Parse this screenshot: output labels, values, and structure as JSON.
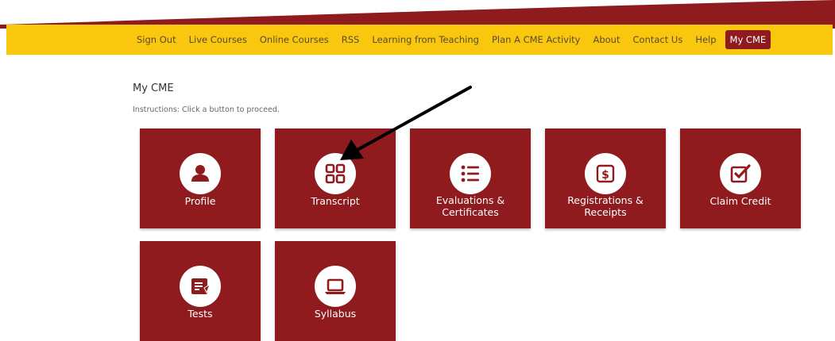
{
  "nav": {
    "items": [
      "Sign Out",
      "Live Courses",
      "Online Courses",
      "RSS",
      "Learning from Teaching",
      "Plan A CME Activity",
      "About",
      "Contact Us",
      "Help"
    ],
    "active": "My CME"
  },
  "page": {
    "title": "My CME",
    "instructions": "Instructions: Click a button to proceed."
  },
  "tiles": [
    {
      "label": "Profile",
      "icon": "user-icon"
    },
    {
      "label": "Transcript",
      "icon": "grid-icon"
    },
    {
      "label": "Evaluations & Certificates",
      "label_lines": [
        "Evaluations &",
        "Certificates"
      ],
      "icon": "list-icon"
    },
    {
      "label": "Registrations & Receipts",
      "label_lines": [
        "Registrations &",
        "Receipts"
      ],
      "icon": "dollar-receipt-icon"
    },
    {
      "label": "Claim Credit",
      "icon": "checkbox-icon"
    },
    {
      "label": "Tests",
      "icon": "test-sheet-icon"
    },
    {
      "label": "Syllabus",
      "icon": "laptop-icon"
    }
  ],
  "colors": {
    "navbar": "#f9c80e",
    "tile": "#8f1b1e",
    "active_nav": "#8f1b1e",
    "swoosh": "#8f1b1e"
  },
  "annotation": "arrow-pointing-to-transcript"
}
